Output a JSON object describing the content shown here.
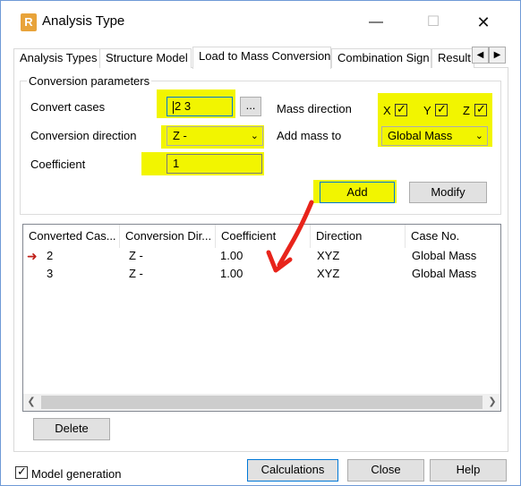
{
  "window": {
    "title": "Analysis Type",
    "app_icon": "R"
  },
  "tabs": [
    {
      "label": "Analysis Types",
      "active": false
    },
    {
      "label": "Structure Model",
      "active": false
    },
    {
      "label": "Load to Mass Conversion",
      "active": true
    },
    {
      "label": "Combination Sign",
      "active": false
    },
    {
      "label": "Result",
      "active": false
    }
  ],
  "params": {
    "legend": "Conversion parameters",
    "convert_cases_label": "Convert cases",
    "convert_cases_value": "2 3",
    "browse_label": "...",
    "conversion_direction_label": "Conversion direction",
    "conversion_direction_value": "Z -",
    "coefficient_label": "Coefficient",
    "coefficient_value": "1",
    "mass_direction_label": "Mass direction",
    "mass_x_label": "X",
    "mass_y_label": "Y",
    "mass_z_label": "Z",
    "mass_x_checked": true,
    "mass_y_checked": true,
    "mass_z_checked": true,
    "add_mass_to_label": "Add mass to",
    "add_mass_to_value": "Global Mass",
    "add_button": "Add",
    "modify_button": "Modify"
  },
  "table": {
    "columns": [
      "Converted Cas...",
      "Conversion Dir...",
      "Coefficient",
      "Direction",
      "Case No."
    ],
    "rows": [
      [
        "2",
        "Z -",
        "1.00",
        "XYZ",
        "Global Mass"
      ],
      [
        "3",
        "Z -",
        "1.00",
        "XYZ",
        "Global Mass"
      ]
    ]
  },
  "footer": {
    "delete_button": "Delete",
    "model_generation_label": "Model generation",
    "model_generation_checked": true,
    "calculations_button": "Calculations",
    "close_button": "Close",
    "help_button": "Help"
  },
  "colors": {
    "highlight": "#f2f500",
    "annotation_arrow": "#e8241b",
    "focus": "#0078d7"
  }
}
